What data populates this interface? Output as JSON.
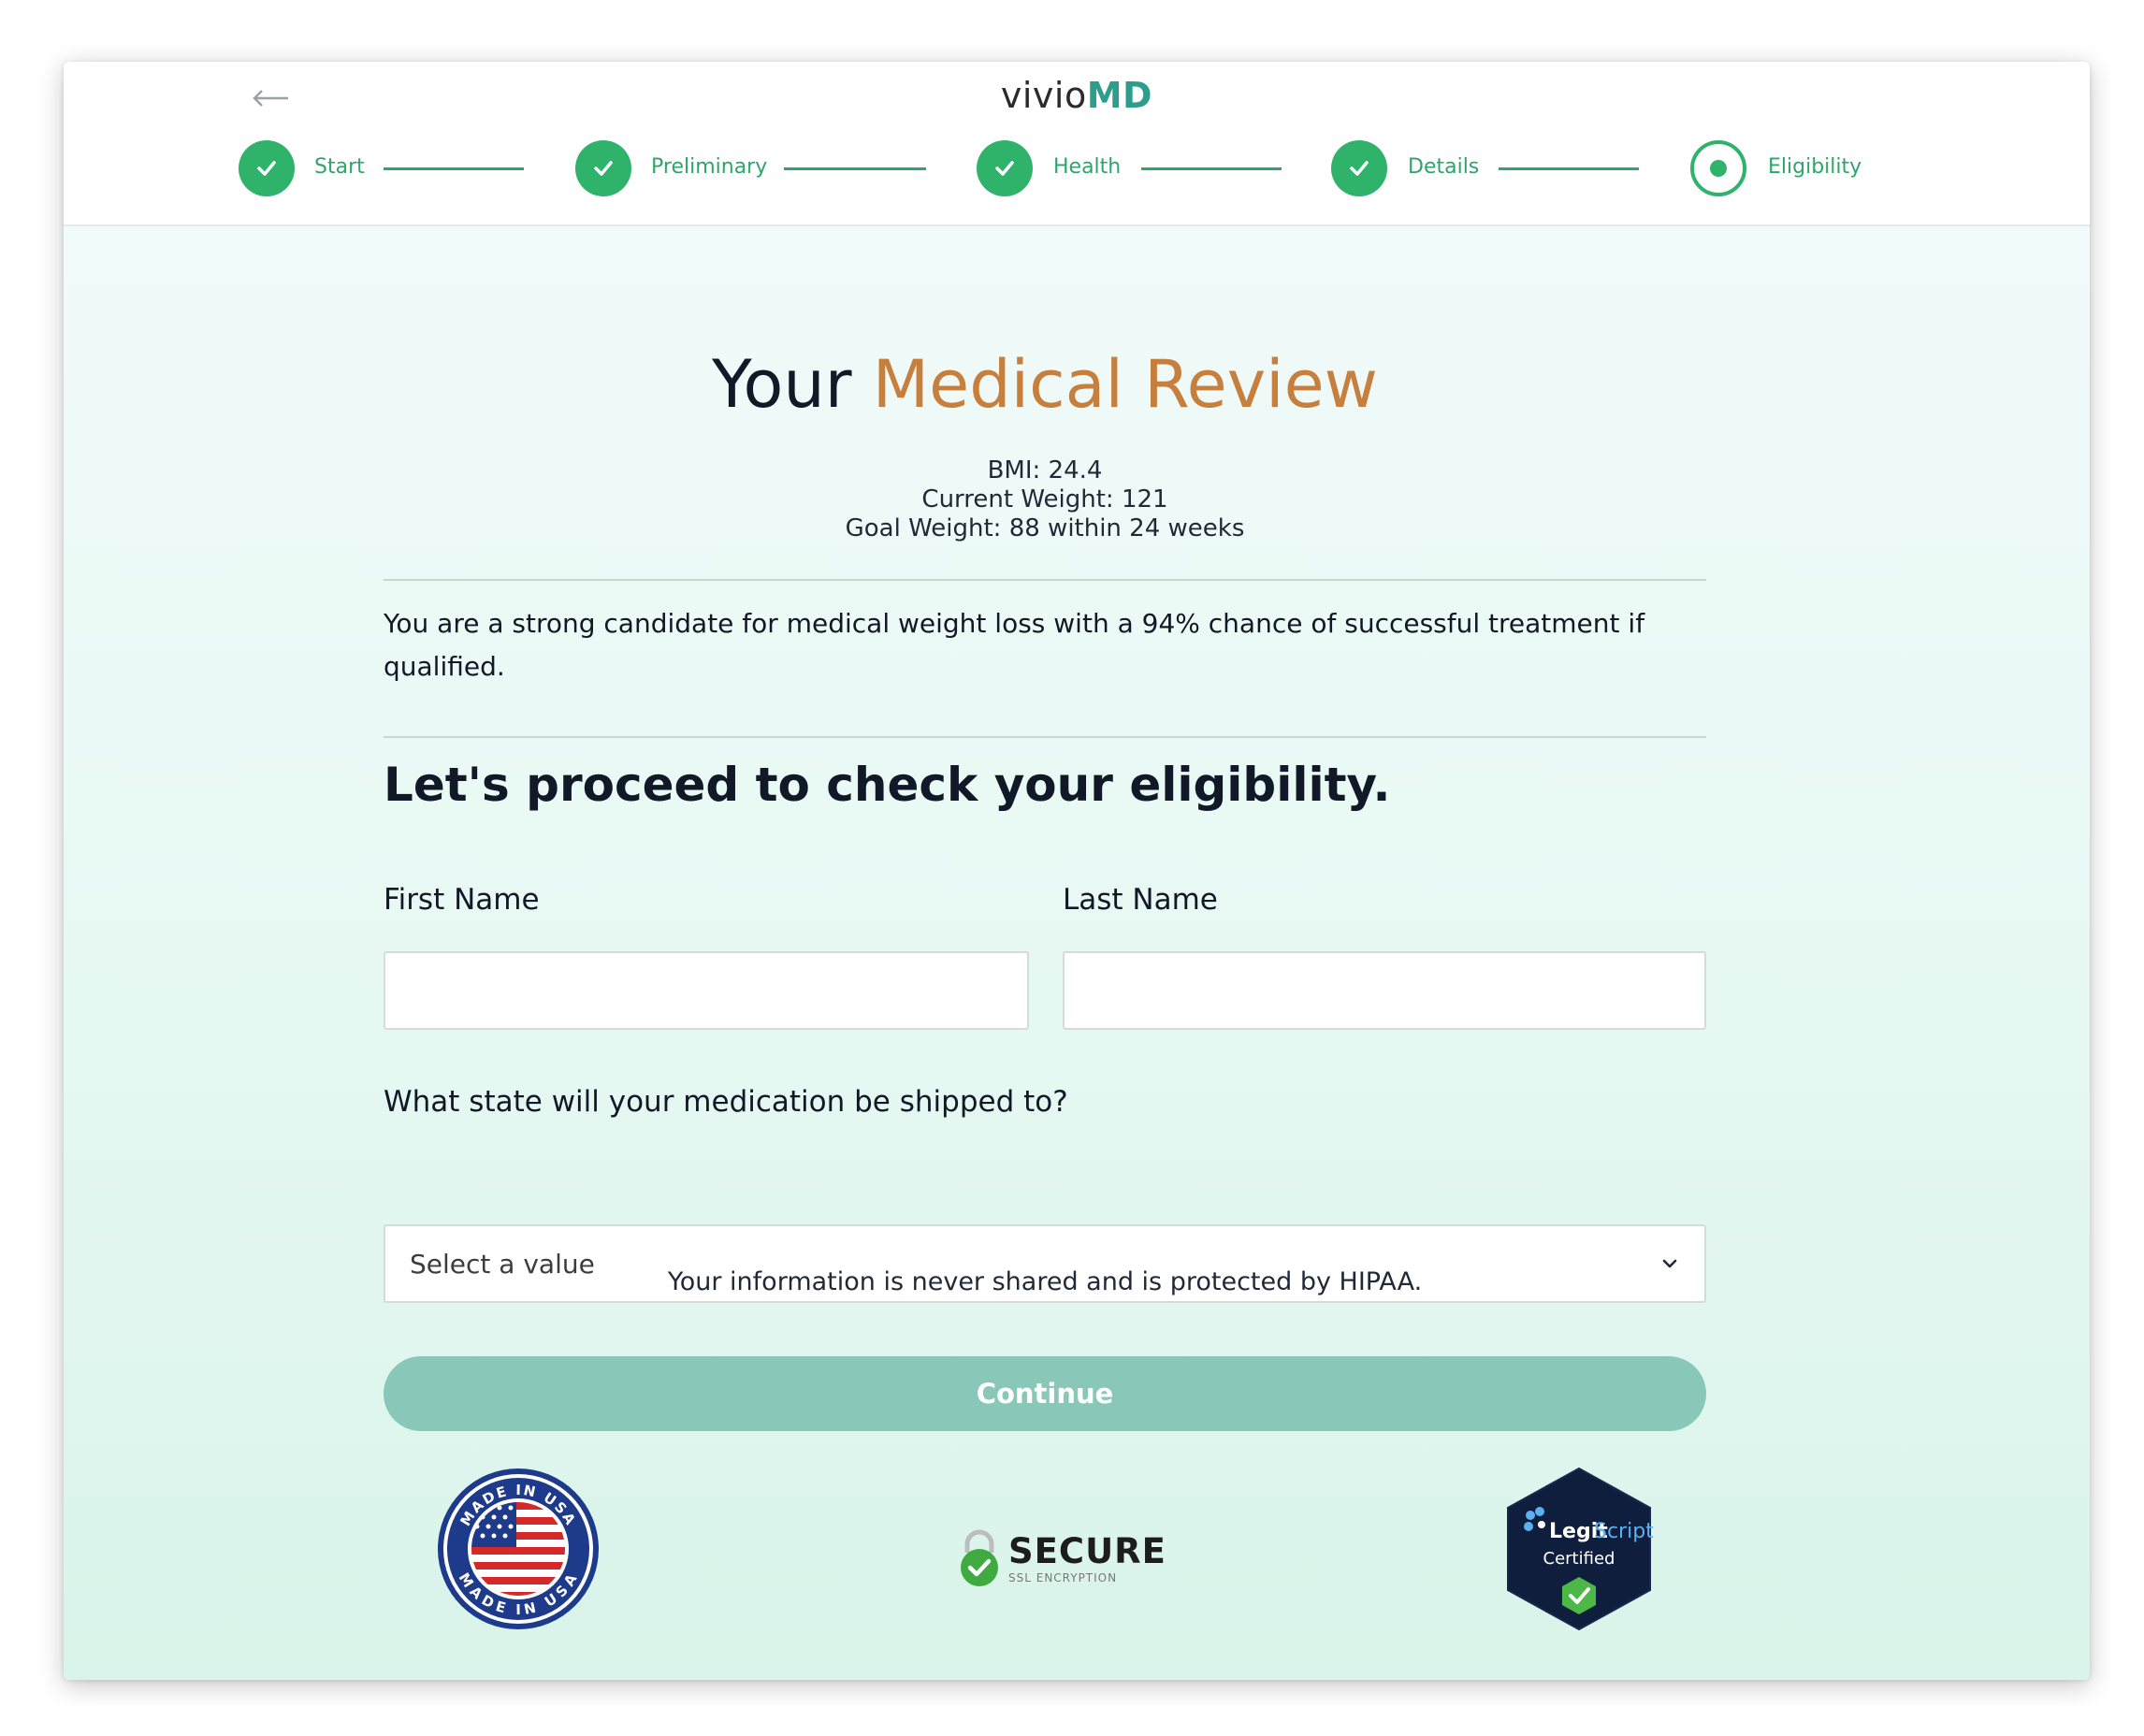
{
  "brand": {
    "name_part1": "vivio",
    "name_part2": "MD"
  },
  "header": {
    "back_icon": "arrow-left-icon",
    "steps": [
      {
        "label": "Start",
        "state": "complete"
      },
      {
        "label": "Preliminary",
        "state": "complete"
      },
      {
        "label": "Health",
        "state": "complete"
      },
      {
        "label": "Details",
        "state": "complete"
      },
      {
        "label": "Eligibility",
        "state": "current"
      }
    ]
  },
  "main": {
    "title_part1": "Your",
    "title_part2": "Medical Review",
    "stats": {
      "bmi": "BMI: 24.4",
      "current_weight": "Current Weight: 121",
      "goal_weight_label": "Goal Weight:",
      "goal_weight_value": "88 within 24 weeks"
    },
    "candidate_text": "You are a strong candidate for medical weight loss with a 94% chance of successful treatment if qualified.",
    "subheading": "Let's proceed to check your eligibility.",
    "form": {
      "first_name_label": "First Name",
      "first_name_value": "",
      "last_name_label": "Last Name",
      "last_name_value": "",
      "state_label": "What state will your medication be shipped to?",
      "state_value": "Select a value"
    },
    "hipaa_text": "Your information is never shared and is protected by HIPAA.",
    "continue_label": "Continue",
    "badges": {
      "made_in_usa": {
        "text_top": "MADE IN USA",
        "text_bottom": "MADE IN USA"
      },
      "secure": {
        "title": "SECURE",
        "subtitle": "SSL ENCRYPTION"
      },
      "legitscript": {
        "name_part1": "Legit",
        "name_part2": "Script",
        "status": "Certified"
      }
    }
  },
  "colors": {
    "step_green": "#2fb36b",
    "brand_teal": "#2e9d8c",
    "title_accent": "#c77f3e",
    "button": "#89c8b9"
  }
}
